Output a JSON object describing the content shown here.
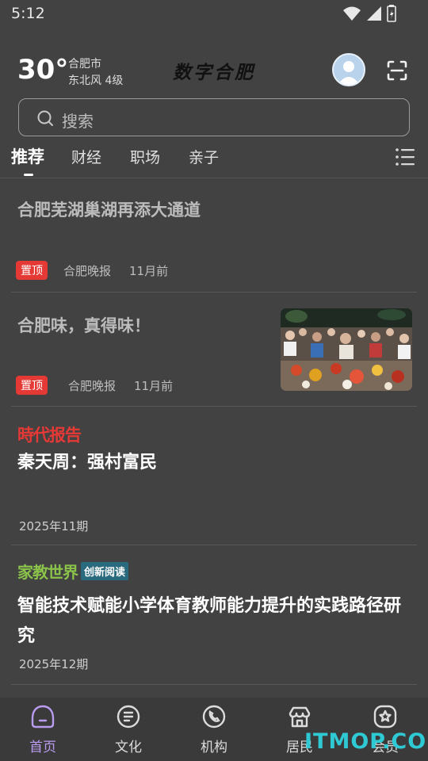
{
  "status_bar": {
    "time": "5:12",
    "icons": [
      "wifi-icon",
      "signal-icon",
      "battery-icon"
    ]
  },
  "header": {
    "temperature": "30°",
    "city": "合肥市",
    "wind": "东北风  4级",
    "app_logo": "数字合肥"
  },
  "search": {
    "placeholder": "搜索"
  },
  "tabs": [
    {
      "label": "推荐",
      "active": true
    },
    {
      "label": "财经",
      "active": false
    },
    {
      "label": "职场",
      "active": false
    },
    {
      "label": "亲子",
      "active": false
    }
  ],
  "articles": [
    {
      "title": "合肥芜湖巢湖再添大通道",
      "badge": "置顶",
      "source": "合肥晚报",
      "time": "11月前"
    },
    {
      "title": "合肥味，真得味！",
      "badge": "置顶",
      "source": "合肥晚报",
      "time": "11月前",
      "thumbnail": "outdoor-dining-crowd-photo"
    },
    {
      "column_logo": "時代报告",
      "title": "秦天周：强村富民",
      "period": "2025年11期"
    },
    {
      "column_logo": "家教世界",
      "column_tag": "创新阅读",
      "title": "智能技术赋能小学体育教师能力提升的实践路径研究",
      "period": "2025年12期"
    }
  ],
  "bottom_nav": [
    {
      "label": "首页",
      "icon": "home-icon",
      "active": true
    },
    {
      "label": "文化",
      "icon": "culture-icon",
      "active": false
    },
    {
      "label": "机构",
      "icon": "phone-icon",
      "active": false
    },
    {
      "label": "居民",
      "icon": "residents-icon",
      "active": false
    },
    {
      "label": "会员",
      "icon": "member-icon",
      "active": false
    }
  ],
  "watermark": "ITMOP.COM",
  "colors": {
    "accent": "#b99cf0",
    "pin_badge": "#e53935",
    "background": "#424242",
    "watermark": "#2fc9d4"
  }
}
